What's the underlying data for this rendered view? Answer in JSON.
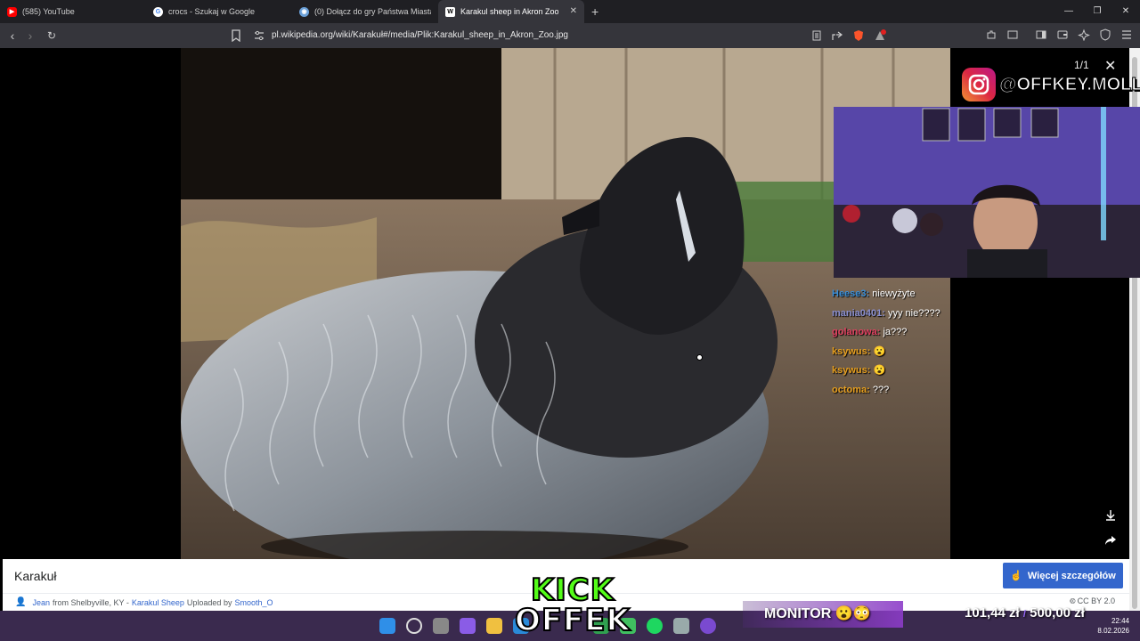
{
  "browser": {
    "tabs": [
      {
        "label": "(585) YouTube",
        "favicon_color": "#ff0000",
        "favicon_glyph": "▶"
      },
      {
        "label": "crocs - Szukaj w Google",
        "favicon_color": "#4285f4",
        "favicon_glyph": "G"
      },
      {
        "label": "(0) Dołącz do gry Państwa Miasta",
        "favicon_color": "#6aa0d8",
        "favicon_glyph": "◉"
      },
      {
        "label": "Karakul sheep in Akron Zoo - Ka",
        "favicon_color": "#ffffff",
        "favicon_glyph": "W",
        "active": true
      }
    ],
    "new_tab_glyph": "+",
    "url": "pl.wikipedia.org/wiki/Karakuł#/media/Plik:Karakul_sheep_in_Akron_Zoo.jpg",
    "brave_badge": "1"
  },
  "viewer": {
    "counter": "1/1",
    "close_glyph": "✕"
  },
  "caption": {
    "title": "Karakuł",
    "more_button": "Więcej szczegółów",
    "credit_author": "Jean",
    "credit_from": "from Shelbyville, KY -",
    "credit_title": "Karakul Sheep",
    "credit_uploaded": "Uploaded by",
    "credit_uploader": "Smooth_O",
    "license": "CC BY 2.0"
  },
  "overlay": {
    "instagram_handle": "@OFFKEY.MOLLY",
    "chat": [
      {
        "user": "Heese3:",
        "msg": "niewyżyte",
        "color": "#3a8fd8"
      },
      {
        "user": "mania0401:",
        "msg": "yyy nie????",
        "color": "#8a8fd0"
      },
      {
        "user": "golanowa:",
        "msg": "ja???",
        "color": "#e04060"
      },
      {
        "user": "ksywus:",
        "msg": "😮",
        "color": "#e8a020"
      },
      {
        "user": "ksywus:",
        "msg": "😮",
        "color": "#e8a020"
      },
      {
        "user": "octoma:",
        "msg": "???",
        "color": "#e8a020"
      }
    ],
    "kick_top": "KICK",
    "kick_bottom": "OFFEK",
    "monitor": "MONITOR 😮😳",
    "money_left": "101,44 zł",
    "money_right": "500,00 zł"
  },
  "system": {
    "time": "22:44",
    "date": "8.02.2026"
  },
  "colors": {
    "tabbar": "#1f1f23",
    "addrbar": "#35353b",
    "accent": "#3366cc",
    "taskbar": "#3a2a4e"
  }
}
